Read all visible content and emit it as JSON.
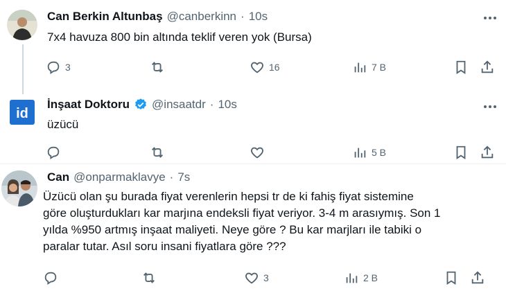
{
  "tweets": [
    {
      "name": "Can Berkin Altunbaş",
      "handle": "@canberkinn",
      "time": "10s",
      "text": "7x4 havuza 800 bin altında teklif veren yok (Bursa)",
      "replies": "3",
      "retweets": "",
      "likes": "16",
      "views": "7 B"
    },
    {
      "name": "İnşaat Doktoru",
      "handle": "@insaatdr",
      "time": "10s",
      "text": "üzücü",
      "replies": "",
      "retweets": "",
      "likes": "",
      "views": "5 B",
      "avatar_text": "id"
    },
    {
      "name": "Can",
      "handle": "@onparmaklavye",
      "time": "7s",
      "text_lines": [
        "Üzücü olan şu burada fiyat verenlerin hepsi tr de ki fahiş fiyat sistemine",
        "göre oluşturdukları kar marjına endeksli fiyat veriyor. 3-4 m arasıymış. Son 1",
        "yılda %950 artmış inşaat maliyeti. Neye göre ? Bu kar marjları ile tabiki o",
        "paralar tutar. Asıl soru insani fiyatlara göre ???"
      ],
      "replies": "",
      "retweets": "",
      "likes": "3",
      "views": "2 B"
    }
  ],
  "colors": {
    "text": "#0f1419",
    "secondary": "#536471",
    "verified": "#1d9bf0",
    "avatar_id_bg": "#1f6fd1"
  }
}
